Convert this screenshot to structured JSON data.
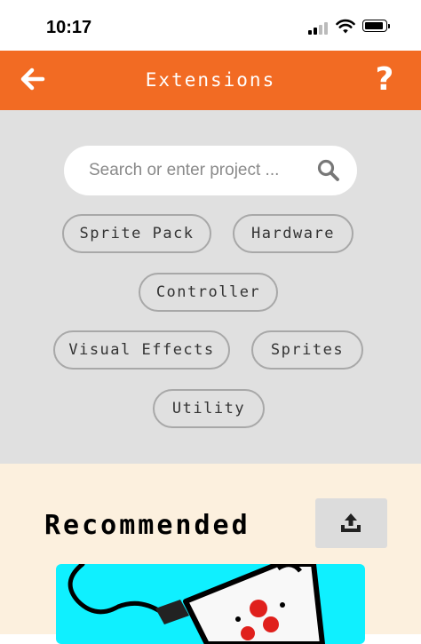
{
  "status_bar": {
    "time": "10:17"
  },
  "header": {
    "title": "Extensions",
    "back_icon": "arrow-left-icon",
    "help_label": "?"
  },
  "search": {
    "placeholder": "Search or enter project ...",
    "value": "",
    "icon": "search-icon"
  },
  "categories": {
    "items": [
      {
        "label": "Sprite Pack"
      },
      {
        "label": "Hardware"
      },
      {
        "label": "Controller"
      },
      {
        "label": "Visual Effects"
      },
      {
        "label": "Sprites"
      },
      {
        "label": "Utility"
      }
    ]
  },
  "recommended": {
    "title": "Recommended",
    "upload_icon": "upload-icon"
  },
  "colors": {
    "header": "#f26b23",
    "search_area": "#e0e0e0",
    "recommended_bg": "#fcf0de",
    "card_bg": "#0ff0ff",
    "chip_border": "#a8a8a8"
  }
}
